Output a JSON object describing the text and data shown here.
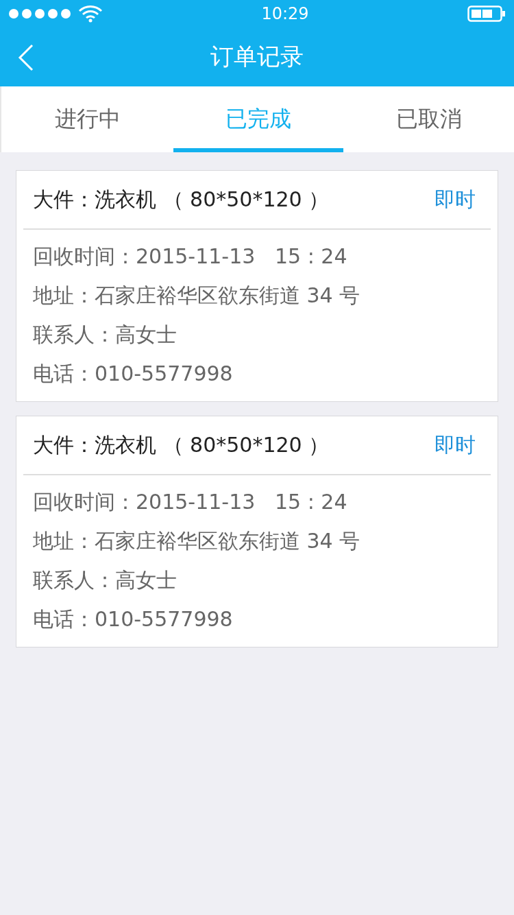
{
  "status_bar": {
    "time": "10:29"
  },
  "nav_bar": {
    "title": "订单记录"
  },
  "tabs": [
    {
      "label": "进行中",
      "selected": false
    },
    {
      "label": "已完成",
      "selected": true
    },
    {
      "label": "已取消",
      "selected": false
    }
  ],
  "orders": [
    {
      "title": "大件：洗衣机 （ 80*50*120 ）",
      "tag": "即时",
      "details": [
        "回收时间：2015-11-13   15 : 24",
        "地址：石家庄裕华区欲东街道 34 号",
        "联系人：高女士",
        "电话：010-5577998"
      ]
    },
    {
      "title": "大件：洗衣机 （ 80*50*120 ）",
      "tag": "即时",
      "details": [
        "回收时间：2015-11-13   15 : 24",
        "地址：石家庄裕华区欲东街道 34 号",
        "联系人：高女士",
        "电话：010-5577998"
      ]
    }
  ]
}
